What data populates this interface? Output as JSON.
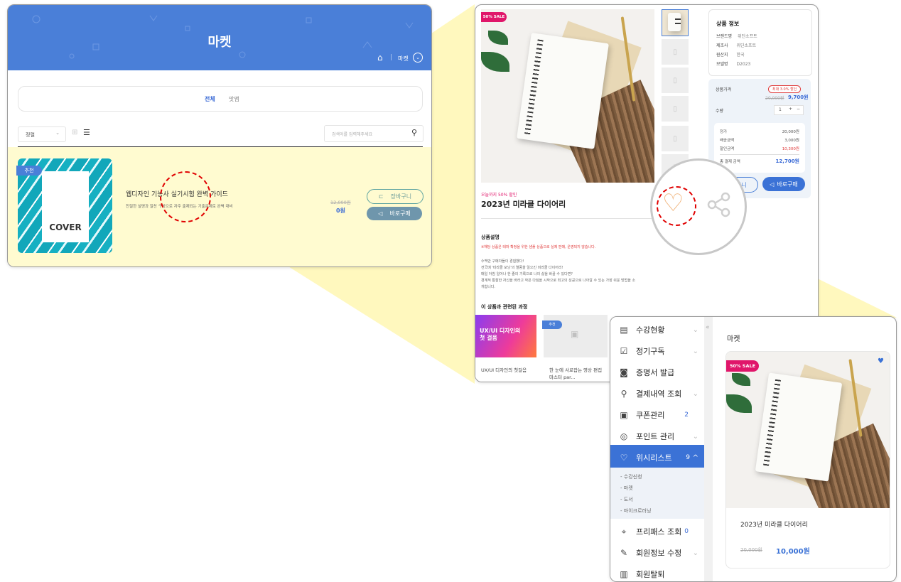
{
  "colors": {
    "brand_blue": "#4a7fd8",
    "highlight_yellow": "#fff7b3",
    "sale_pink": "#e0166a",
    "accent_red": "#e03a3a"
  },
  "market_list": {
    "title": "마켓",
    "breadcrumb_current": "마켓",
    "tabs": [
      "전체",
      "맛맵"
    ],
    "sort_label": "정렬",
    "search_placeholder": "검색어를 입력해주세요",
    "product": {
      "badge": "추천",
      "cover_text": "COVER",
      "title": "웹디자인 기능사 실기시험 완벽 가이드",
      "desc": "친절한 설명과 알찬 구성으로 자주 출제되는 기출문제로 완벽 대비",
      "price_original": "12,000원",
      "price_final": "0원",
      "cart_label": "장바구니",
      "buy_label": "바로구매"
    }
  },
  "detail": {
    "sale_badge": "50% SALE",
    "info_title": "상품 정보",
    "info_rows": [
      {
        "k": "브랜드명",
        "v": "위딘소프트"
      },
      {
        "k": "제조사",
        "v": "위딘소프트"
      },
      {
        "k": "원산지",
        "v": "한국"
      },
      {
        "k": "모델명",
        "v": "D2023"
      }
    ],
    "price_label": "상품가격",
    "discount_badge": "최대 3.0% 할인",
    "price_original": "20,000원",
    "price_final": "9,700원",
    "qty_label": "수량",
    "qty_value": "1",
    "sum_rows": [
      {
        "k": "정가",
        "v": "20,000원"
      },
      {
        "k": "배송금액",
        "v": "3,000원"
      },
      {
        "k": "할인금액",
        "v": "10,300원"
      }
    ],
    "total_label": "총 결제 금액",
    "total_value": "12,700원",
    "cart_label": "장바구니",
    "buy_label": "바로구매",
    "promo_text": "오늘까지 50% 할인",
    "product_title": "2023년 미라클 다이어리",
    "desc_title": "상품설명",
    "desc_warning": "※해당 상품은 테마 확정을 위한 샘플 상품으로 실제 판매, 운영되지 않습니다.",
    "desc_lines": [
      "수백만 구매자들이 경험했다!",
      "전국에 '미라클 모닝'의 열풍을 일으킨 미라클 다이어리!",
      "매일 아침 일어나 한 줄의 기록으로 나의 삶을 바꿀 수 있다면?",
      "경계적 통찰한 자신을 바라고 작은 다짐을 시작으로 최고의 성공으로 나아갈 수 있는 가장 쉬운 방법을 소",
      "개합니다."
    ],
    "related_title": "이 상품과 관련된 과정",
    "related": [
      {
        "badge": "추천",
        "banner": "UX/UI 디자인의 첫 걸음",
        "title": "UX/UI 디자인의 첫걸음"
      },
      {
        "badge": "추천",
        "title": "한 눈에 사로잡는 영상 편집 마스터 par..."
      }
    ]
  },
  "mypage": {
    "menu": [
      {
        "icon": "▤",
        "label": "수강현황",
        "chev": "⌄",
        "count": ""
      },
      {
        "icon": "☑",
        "label": "정기구독",
        "chev": "⌄",
        "count": ""
      },
      {
        "icon": "◙",
        "label": "증명서 발급",
        "chev": "",
        "count": ""
      },
      {
        "icon": "⚲",
        "label": "결제내역 조회",
        "chev": "⌄",
        "count": ""
      },
      {
        "icon": "▣",
        "label": "쿠폰관리",
        "chev": "",
        "count": "2"
      },
      {
        "icon": "◎",
        "label": "포인트 관리",
        "chev": "⌄",
        "count": ""
      },
      {
        "icon": "♡",
        "label": "위시리스트",
        "chev": "^",
        "count": "9"
      },
      {
        "icon": "⌖",
        "label": "프리패스 조회",
        "chev": "",
        "count": "0"
      },
      {
        "icon": "✎",
        "label": "회원정보 수정",
        "chev": "⌄",
        "count": ""
      },
      {
        "icon": "▥",
        "label": "회원탈퇴",
        "chev": "",
        "count": ""
      }
    ],
    "submenu": [
      "- 수강신청",
      "- 마켓",
      "- 도서",
      "- 마이크로러닝"
    ],
    "collapse_icon": "«",
    "section_title": "마켓",
    "card": {
      "sale_badge": "50% SALE",
      "title": "2023년 미라클 다이어리",
      "price_original": "20,000원",
      "price_final": "10,000원"
    }
  }
}
